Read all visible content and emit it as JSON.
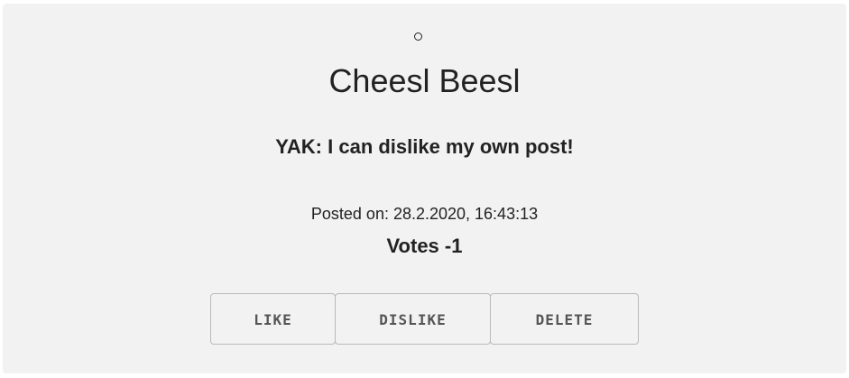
{
  "post": {
    "author": "Cheesl Beesl",
    "text": "YAK: I can dislike my own post!",
    "posted_on": "Posted on: 28.2.2020, 16:43:13",
    "votes": "Votes -1"
  },
  "icons": {
    "avatar": "avatar-circle-icon"
  },
  "actions": {
    "like_label": "LIKE",
    "dislike_label": "DISLIKE",
    "delete_label": "DELETE"
  },
  "colors": {
    "card_background": "#f2f2f2",
    "text": "#222222",
    "button_text": "#555555",
    "button_border": "#b9b9b9"
  }
}
